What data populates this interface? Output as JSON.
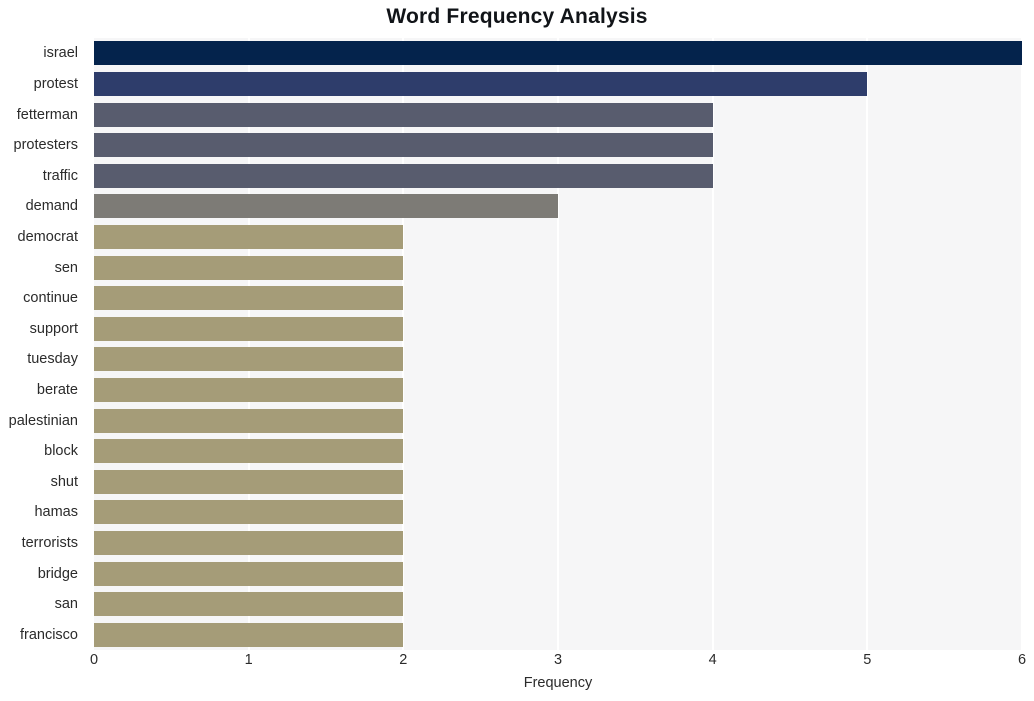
{
  "chart_data": {
    "type": "bar",
    "orientation": "horizontal",
    "title": "Word Frequency Analysis",
    "xlabel": "Frequency",
    "ylabel": "",
    "xlim": [
      0,
      6
    ],
    "xticks": [
      0,
      1,
      2,
      3,
      4,
      5,
      6
    ],
    "xtick_labels": [
      "0",
      "1",
      "2",
      "3",
      "4",
      "5",
      "6"
    ],
    "grid": true,
    "grid_axis": "x",
    "legend": null,
    "categories": [
      "israel",
      "protest",
      "fetterman",
      "protesters",
      "traffic",
      "demand",
      "democrat",
      "sen",
      "continue",
      "support",
      "tuesday",
      "berate",
      "palestinian",
      "block",
      "shut",
      "hamas",
      "terrorists",
      "bridge",
      "san",
      "francisco"
    ],
    "values": [
      6,
      5,
      4,
      4,
      4,
      3,
      2,
      2,
      2,
      2,
      2,
      2,
      2,
      2,
      2,
      2,
      2,
      2,
      2,
      2
    ],
    "bar_colors": [
      "#04234c",
      "#2e3d6b",
      "#585c6e",
      "#585c6e",
      "#585c6e",
      "#7d7b76",
      "#a59c78",
      "#a59c78",
      "#a59c78",
      "#a59c78",
      "#a59c78",
      "#a59c78",
      "#a59c78",
      "#a59c78",
      "#a59c78",
      "#a59c78",
      "#a59c78",
      "#a59c78",
      "#a59c78",
      "#a59c78"
    ],
    "plot_background": "#f6f6f7",
    "figure_background": "#ffffff",
    "gridline_color": "#ffffff",
    "text_color": "#2b2b2b",
    "title_color": "#111418"
  }
}
